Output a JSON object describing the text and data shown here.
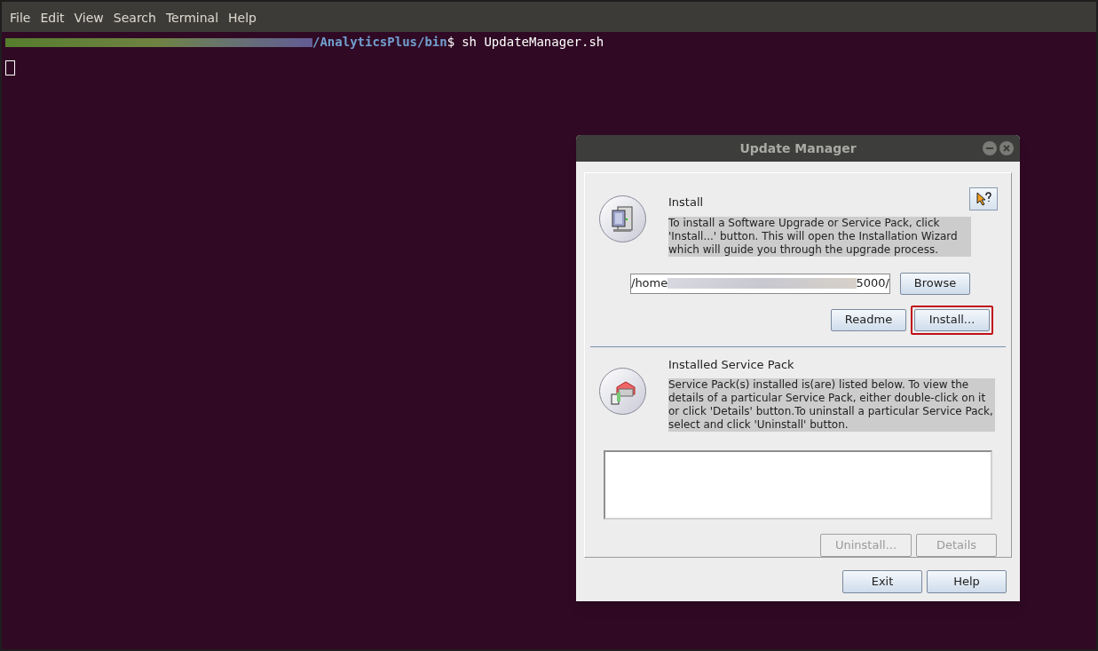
{
  "terminal": {
    "menu": [
      "File",
      "Edit",
      "View",
      "Search",
      "Terminal",
      "Help"
    ],
    "prompt_path": "/AnalyticsPlus/bin",
    "prompt_sign": "$",
    "command": "sh UpdateManager.sh"
  },
  "dialog": {
    "title": "Update Manager",
    "install": {
      "heading": "Install",
      "description": "To install a Software Upgrade or Service Pack, click 'Install...' button. This will open the Installation Wizard which will guide you through the upgrade process.",
      "path_start": "/home",
      "path_end": "5000/",
      "buttons": [
        {
          "label": "Browse",
          "disabled": false,
          "highlighted": false
        },
        {
          "label": "Readme",
          "disabled": false,
          "highlighted": false
        },
        {
          "label": "Install...",
          "disabled": false,
          "highlighted": true
        }
      ]
    },
    "installed": {
      "heading": "Installed Service Pack",
      "description": "Service Pack(s) installed is(are) listed below. To view the details of a particular Service Pack, either double-click on it or click 'Details' button.To uninstall a particular Service Pack, select and click 'Uninstall' button.",
      "buttons": [
        {
          "label": "Uninstall...",
          "disabled": true
        },
        {
          "label": "Details",
          "disabled": true
        }
      ]
    },
    "footer_buttons": [
      {
        "label": "Exit"
      },
      {
        "label": "Help"
      }
    ]
  }
}
